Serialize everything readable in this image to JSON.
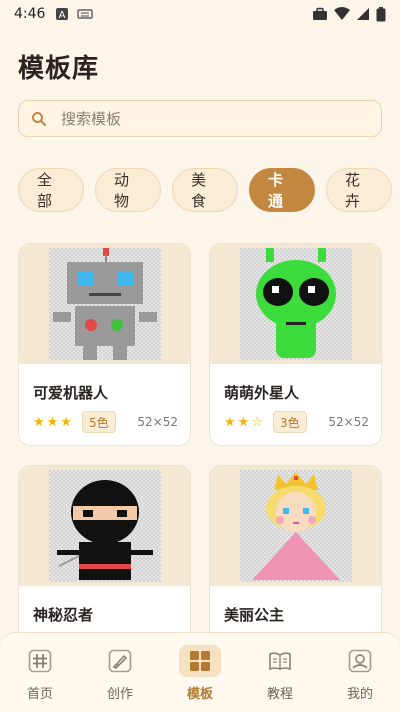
{
  "status": {
    "time": "4:46"
  },
  "page": {
    "title": "模板库"
  },
  "search": {
    "placeholder": "搜索模板"
  },
  "categories": [
    {
      "label": "全部"
    },
    {
      "label": "动物"
    },
    {
      "label": "美食"
    },
    {
      "label": "卡通"
    },
    {
      "label": "花卉"
    }
  ],
  "templates": [
    {
      "name": "可爱机器人",
      "stars": "★★★",
      "colors": "5色",
      "size": "52×52",
      "icon": "robot"
    },
    {
      "name": "萌萌外星人",
      "stars": "★★☆",
      "colors": "3色",
      "size": "52×52",
      "icon": "alien"
    },
    {
      "name": "神秘忍者",
      "icon": "ninja"
    },
    {
      "name": "美丽公主",
      "icon": "princess"
    }
  ],
  "nav": [
    {
      "label": "首页",
      "icon": "hash-icon"
    },
    {
      "label": "创作",
      "icon": "brush-icon"
    },
    {
      "label": "模板",
      "icon": "grid-icon"
    },
    {
      "label": "教程",
      "icon": "book-icon"
    },
    {
      "label": "我的",
      "icon": "user-icon"
    }
  ],
  "colors": {
    "accent": "#c4873f",
    "background": "#fcf5ea"
  }
}
